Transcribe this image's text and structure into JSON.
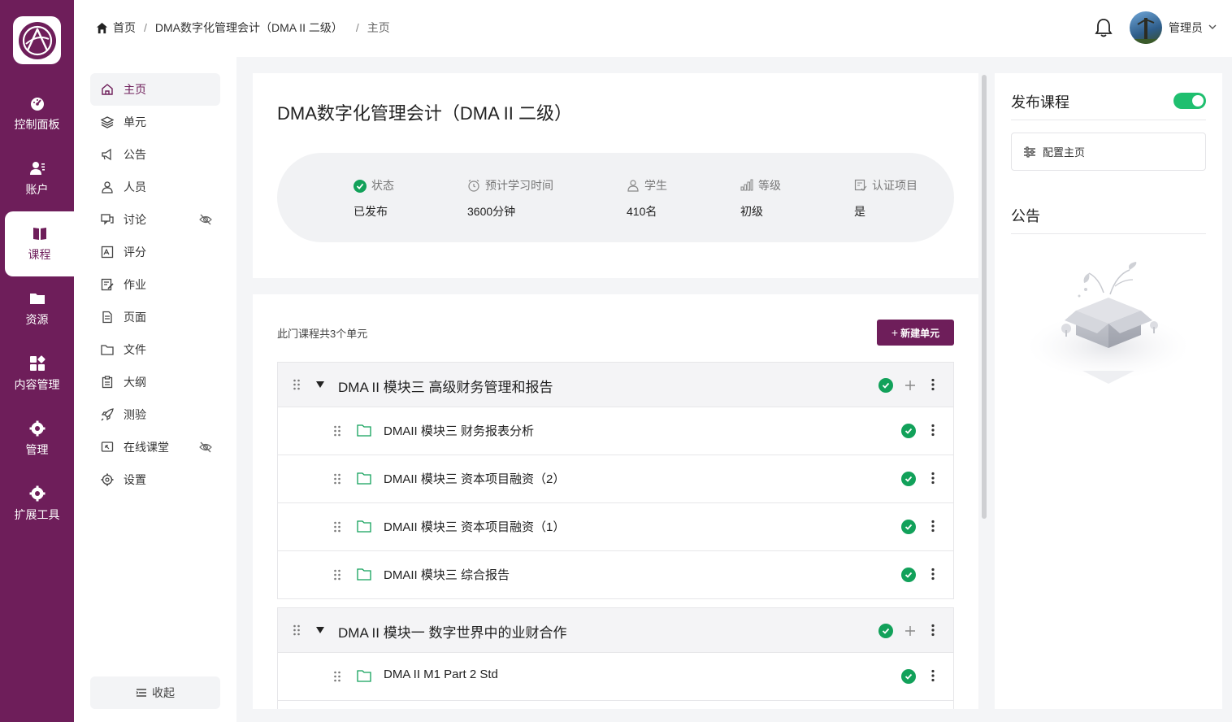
{
  "rail": {
    "items": [
      {
        "label": "控制面板",
        "icon": "dashboard-icon"
      },
      {
        "label": "账户",
        "icon": "account-icon"
      },
      {
        "label": "课程",
        "icon": "book-icon",
        "active": true
      },
      {
        "label": "资源",
        "icon": "folder-icon"
      },
      {
        "label": "内容管理",
        "icon": "grid-icon"
      },
      {
        "label": "管理",
        "icon": "gear-icon"
      },
      {
        "label": "扩展工具",
        "icon": "gear-icon"
      }
    ]
  },
  "subnav": {
    "items": [
      {
        "label": "主页",
        "icon": "home-icon",
        "active": true
      },
      {
        "label": "单元",
        "icon": "layers-icon"
      },
      {
        "label": "公告",
        "icon": "megaphone-icon"
      },
      {
        "label": "人员",
        "icon": "people-icon"
      },
      {
        "label": "讨论",
        "icon": "chat-icon",
        "hidden": true
      },
      {
        "label": "评分",
        "icon": "grade-icon"
      },
      {
        "label": "作业",
        "icon": "edit-icon"
      },
      {
        "label": "页面",
        "icon": "page-icon"
      },
      {
        "label": "文件",
        "icon": "folder-icon"
      },
      {
        "label": "大纲",
        "icon": "clipboard-icon"
      },
      {
        "label": "测验",
        "icon": "rocket-icon"
      },
      {
        "label": "在线课堂",
        "icon": "screen-icon",
        "hidden": true
      },
      {
        "label": "设置",
        "icon": "gear-icon"
      }
    ],
    "collapse_label": "收起"
  },
  "topbar": {
    "breadcrumb": [
      "首页",
      "DMA数字化管理会计（DMA II 二级）",
      "主页"
    ],
    "user_name": "管理员"
  },
  "course": {
    "title": "DMA数字化管理会计（DMA II 二级）",
    "stats": [
      {
        "label": "状态",
        "value": "已发布",
        "icon": "check-circle-icon"
      },
      {
        "label": "预计学习时间",
        "value": "3600分钟",
        "icon": "clock-icon"
      },
      {
        "label": "学生",
        "value": "410名",
        "icon": "student-icon"
      },
      {
        "label": "等级",
        "value": "初级",
        "icon": "level-icon"
      },
      {
        "label": "认证项目",
        "value": "是",
        "icon": "certificate-icon"
      }
    ]
  },
  "units": {
    "count_text": "此门课程共3个单元",
    "new_button": "新建单元",
    "sections": [
      {
        "title": "DMA II 模块三 高级财务管理和报告",
        "items": [
          "DMAII 模块三 财务报表分析",
          "DMAII 模块三 资本项目融资（2）",
          "DMAII 模块三 资本项目融资（1）",
          "DMAII 模块三 综合报告"
        ]
      },
      {
        "title": "DMA II 模块一 数字世界中的业财合作",
        "items": [
          "DMA II M1 Part 2 Std"
        ]
      }
    ]
  },
  "right_panel": {
    "publish_label": "发布课程",
    "published": true,
    "config_label": "配置主页",
    "notice_label": "公告"
  },
  "colors": {
    "brand": "#6e1e5a",
    "success": "#12a15a",
    "toggle_on": "#1fbf6f"
  }
}
